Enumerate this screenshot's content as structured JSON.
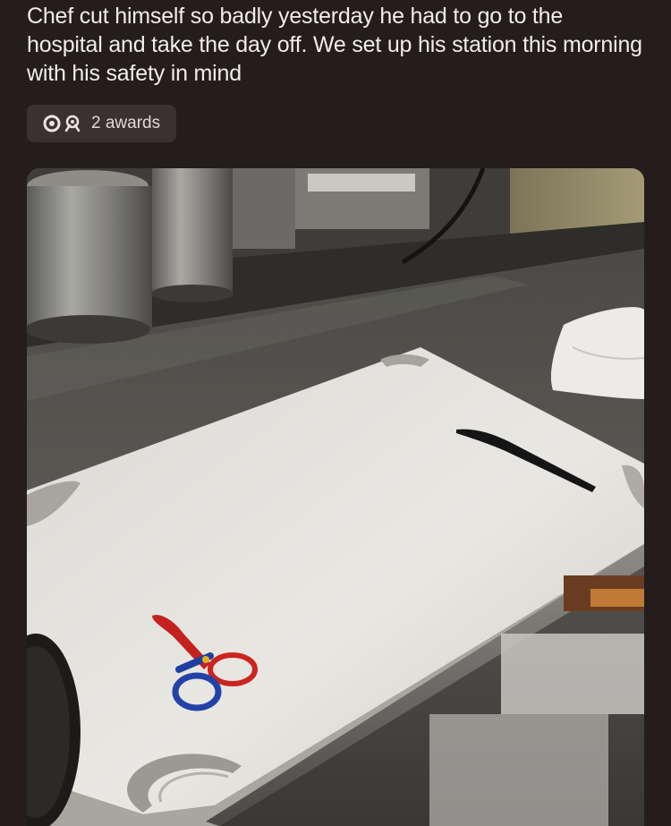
{
  "post": {
    "title": "Chef cut himself so badly yesterday he had to go to the hospital and take the day off. We set up his station this morning with his safety in mind",
    "awards_label": "2 awards",
    "award_icons": [
      "silver-award-icon",
      "helpful-award-icon"
    ]
  },
  "colors": {
    "background": "#241d1c",
    "chip": "#3a3231",
    "text": "#efeded"
  }
}
